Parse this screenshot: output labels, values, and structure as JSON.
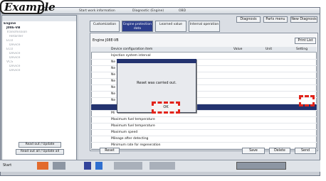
{
  "example_label": "Example",
  "window": {
    "tabs": [
      "WS2 Server",
      "Start work information",
      "Diagnostic (Engine)",
      "OBD"
    ]
  },
  "sidebar": {
    "items": [
      {
        "label": "Engine",
        "root": true
      },
      {
        "label": "J08E-VB",
        "root": true
      },
      {
        "label": "Transmission",
        "root": false
      },
      {
        "label": "Retarder",
        "root": false
      },
      {
        "label": "ECU",
        "root": false
      },
      {
        "label": "Device",
        "root": false
      },
      {
        "label": "ECU",
        "root": false
      },
      {
        "label": "Device",
        "root": false
      },
      {
        "label": "Device",
        "root": false
      },
      {
        "label": "VCS",
        "root": false
      },
      {
        "label": "Device",
        "root": false
      },
      {
        "label": "Device",
        "root": false
      }
    ],
    "btn_read_update": "Read out / Update",
    "btn_read_all": "Read out all / Update all"
  },
  "toolbar": {
    "diagnosis": "Diagnosis",
    "parts_menu": "Parts menu",
    "new_diagnosis": "New Diagnosis"
  },
  "tabs": [
    {
      "label": "Customization",
      "active": false
    },
    {
      "label": "Engine protection data",
      "active": true
    },
    {
      "label": "Learned value",
      "active": false
    },
    {
      "label": "Internal operation",
      "active": false
    }
  ],
  "panel": {
    "engine_label": "Engine J08E-VB",
    "print_list": "Print List"
  },
  "table": {
    "headers": [
      "",
      "Device configuration item",
      "Value",
      "Unit",
      "Setting"
    ],
    "rows": [
      {
        "no": "",
        "item": "Injection system interval",
        "value": "",
        "unit": "",
        "selected": false
      },
      {
        "no": "",
        "item": "Ne",
        "value": "",
        "unit": "",
        "selected": false
      },
      {
        "no": "",
        "item": "Ne",
        "value": "",
        "unit": "",
        "selected": false
      },
      {
        "no": "",
        "item": "Ne",
        "value": "",
        "unit": "",
        "selected": false
      },
      {
        "no": "",
        "item": "Ne",
        "value": "",
        "unit": "",
        "selected": false
      },
      {
        "no": "",
        "item": "Ne",
        "value": "",
        "unit": "",
        "selected": false
      },
      {
        "no": "",
        "item": "Ne",
        "value": "",
        "unit": "",
        "selected": false
      },
      {
        "no": "",
        "item": "Ne",
        "value": "",
        "unit": "",
        "selected": false
      },
      {
        "no": "",
        "item": "",
        "value": "",
        "unit": "",
        "selected": true
      },
      {
        "no": "",
        "item": "Mi",
        "value": "",
        "unit": "",
        "selected": false
      },
      {
        "no": "",
        "item": "Maximum fuel temperature",
        "value": "",
        "unit": "",
        "selected": false
      },
      {
        "no": "",
        "item": "Maximum fuel temperature",
        "value": "",
        "unit": "",
        "selected": false
      },
      {
        "no": "",
        "item": "Maximum speed",
        "value": "",
        "unit": "",
        "selected": false
      },
      {
        "no": "",
        "item": "Mileage after detecting",
        "value": "",
        "unit": "",
        "selected": false
      },
      {
        "no": "",
        "item": "Minimum rate for regeneration",
        "value": "",
        "unit": "",
        "selected": false
      }
    ]
  },
  "dialog": {
    "title": "",
    "message": "Reset was carried out.",
    "ok": "OK"
  },
  "bottom": {
    "reset": "Reset",
    "save": "Save",
    "delete": "Delete",
    "send": "Send"
  },
  "taskbar": {
    "start": "Start"
  },
  "colors": {
    "accent": "#23336f",
    "highlight": "#e2231a"
  }
}
